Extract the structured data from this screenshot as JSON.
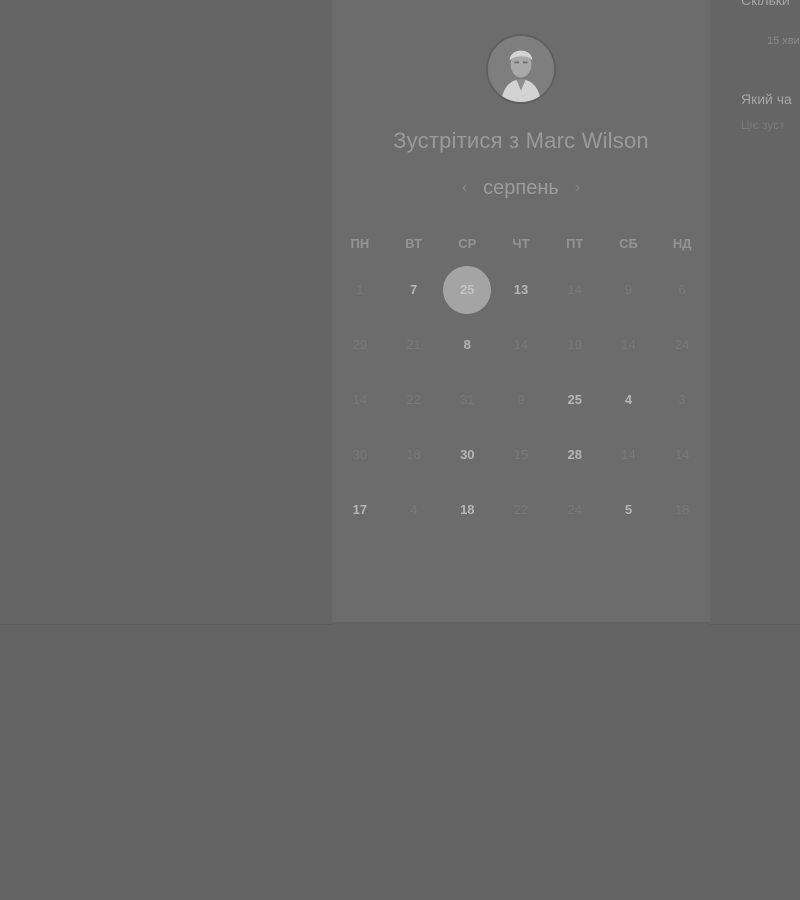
{
  "booking": {
    "title": "Зустрітися з Marc Wilson",
    "month": "серпень",
    "prev_icon": "chevron-left-icon",
    "next_icon": "chevron-right-icon",
    "weekdays": [
      "ПН",
      "ВТ",
      "СР",
      "ЧТ",
      "ПТ",
      "СБ",
      "НД"
    ],
    "weeks": [
      [
        {
          "n": "1",
          "s": "dim"
        },
        {
          "n": "7",
          "s": "avail"
        },
        {
          "n": "25",
          "s": "selected"
        },
        {
          "n": "13",
          "s": "avail"
        },
        {
          "n": "14",
          "s": "dim"
        },
        {
          "n": "9",
          "s": "dim"
        },
        {
          "n": "6",
          "s": "dim"
        }
      ],
      [
        {
          "n": "29",
          "s": "dim"
        },
        {
          "n": "21",
          "s": "dim"
        },
        {
          "n": "8",
          "s": "avail"
        },
        {
          "n": "14",
          "s": "dim"
        },
        {
          "n": "19",
          "s": "dim"
        },
        {
          "n": "14",
          "s": "dim"
        },
        {
          "n": "24",
          "s": "dim"
        }
      ],
      [
        {
          "n": "14",
          "s": "dim"
        },
        {
          "n": "22",
          "s": "dim"
        },
        {
          "n": "31",
          "s": "dim"
        },
        {
          "n": "9",
          "s": "dim"
        },
        {
          "n": "25",
          "s": "avail"
        },
        {
          "n": "4",
          "s": "avail"
        },
        {
          "n": "3",
          "s": "dim"
        }
      ],
      [
        {
          "n": "30",
          "s": "dim"
        },
        {
          "n": "18",
          "s": "dim"
        },
        {
          "n": "30",
          "s": "avail"
        },
        {
          "n": "15",
          "s": "dim"
        },
        {
          "n": "28",
          "s": "avail"
        },
        {
          "n": "14",
          "s": "dim"
        },
        {
          "n": "14",
          "s": "dim"
        }
      ],
      [
        {
          "n": "17",
          "s": "avail"
        },
        {
          "n": "4",
          "s": "dim"
        },
        {
          "n": "18",
          "s": "avail"
        },
        {
          "n": "22",
          "s": "dim"
        },
        {
          "n": "24",
          "s": "dim"
        },
        {
          "n": "5",
          "s": "avail"
        },
        {
          "n": "18",
          "s": "dim"
        }
      ]
    ]
  },
  "side": {
    "q1": "Скільки",
    "q1_meta": "15 хви",
    "q2": "Який ча",
    "q2_sub": "Ціє зуст"
  },
  "colors": {
    "overlay": "#636363",
    "card": "#6c6c6c",
    "selected": "#a4a4a4"
  }
}
